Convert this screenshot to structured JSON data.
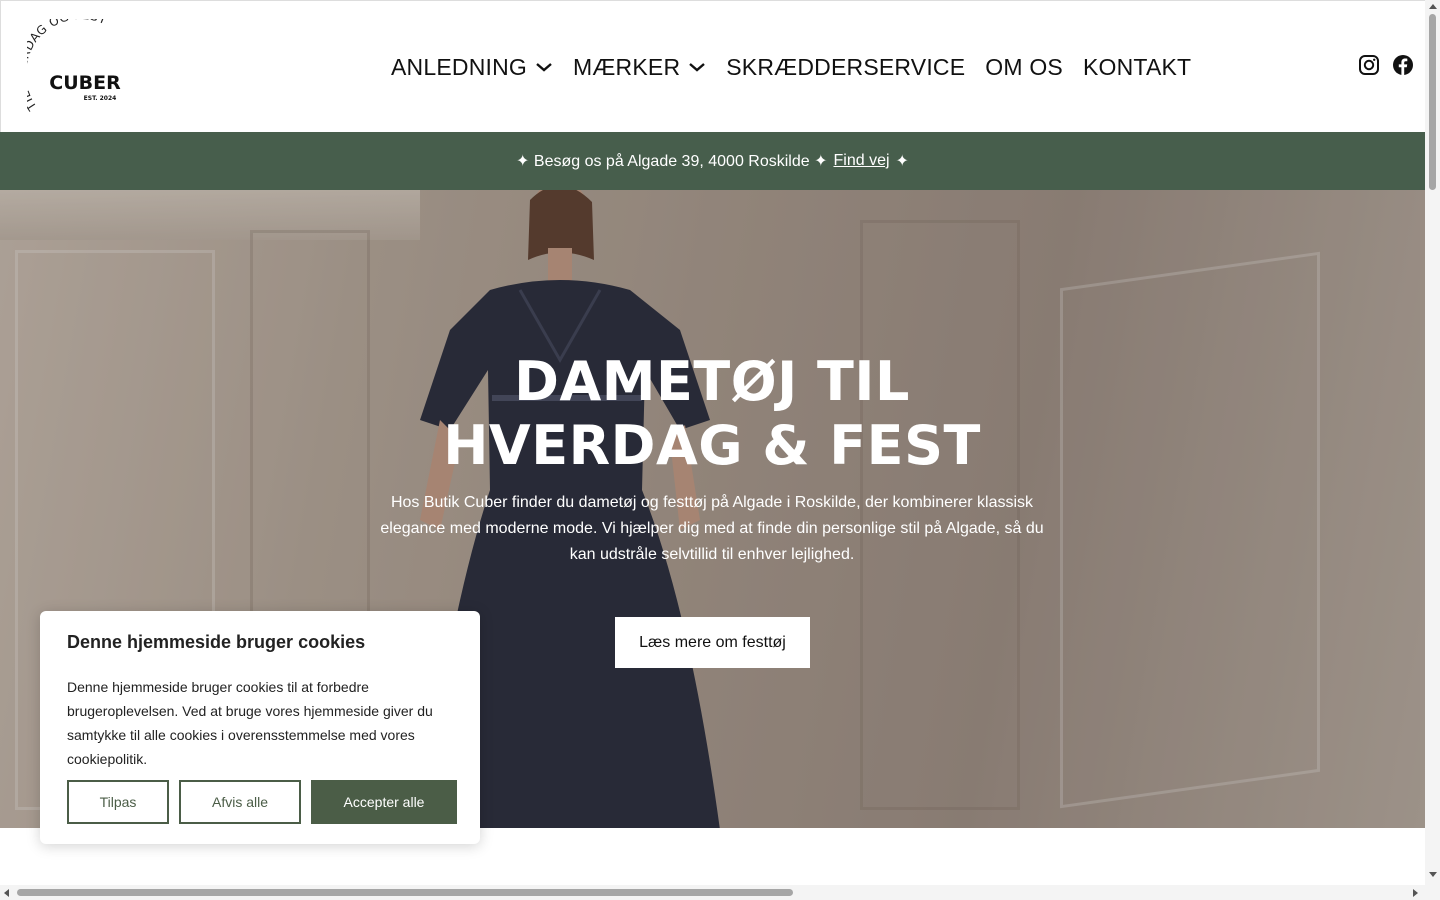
{
  "logo": {
    "arc_text": "TIL HVERDAG OG FEST",
    "brand": "CUBER",
    "established": "EST. 2024"
  },
  "nav": {
    "items": [
      {
        "label": "ANLEDNING",
        "has_dropdown": true
      },
      {
        "label": "MÆRKER",
        "has_dropdown": true
      },
      {
        "label": "SKRÆDDERSERVICE",
        "has_dropdown": false
      },
      {
        "label": "OM OS",
        "has_dropdown": false
      },
      {
        "label": "KONTAKT",
        "has_dropdown": false
      }
    ]
  },
  "social": {
    "icons": [
      "instagram-icon",
      "facebook-icon"
    ]
  },
  "announcement": {
    "prefix": "✦ Besøg os på Algade 39, 4000 Roskilde ✦",
    "link": "Find vej",
    "suffix": "✦",
    "background": "#475e4c"
  },
  "hero": {
    "title": "DAMETØJ TIL HVERDAG & FEST",
    "text": "Hos Butik Cuber finder du dametøj og festtøj på Algade i Roskilde, der kombinerer klassisk elegance med moderne mode. Vi hjælper dig med at finde din personlige stil på Algade, så du kan udstråle selvtillid til enhver lejlighed.",
    "button": "Læs mere om festtøj"
  },
  "cookie": {
    "title": "Denne hjemmeside bruger cookies",
    "text": "Denne hjemmeside bruger cookies til at forbedre brugeroplevelsen. Ved at bruge vores hjemmeside giver du samtykke til alle cookies i overensstemmelse med vores cookiepolitik.",
    "customize": "Tilpas",
    "reject": "Afvis alle",
    "accept": "Accepter alle",
    "accent": "#4b5d47"
  }
}
